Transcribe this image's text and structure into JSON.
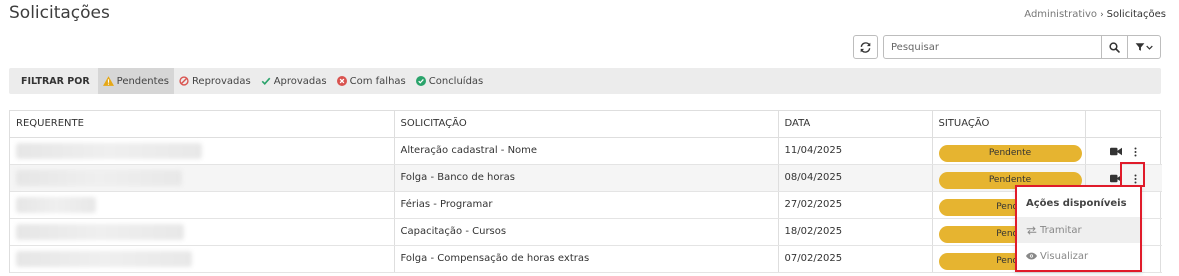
{
  "page": {
    "title": "Solicitações",
    "breadcrumb": {
      "parent": "Administrativo",
      "separator": "›",
      "current": "Solicitações"
    }
  },
  "toolbar": {
    "search_placeholder": "Pesquisar",
    "icons": {
      "refresh": "refresh-icon",
      "search": "search-icon",
      "filter": "filter-icon"
    }
  },
  "filter_bar": {
    "label": "FILTRAR POR",
    "items": [
      {
        "label": "Pendentes",
        "icon": "warning-icon",
        "color": "#e6a817",
        "active": true
      },
      {
        "label": "Reprovadas",
        "icon": "forbidden-icon",
        "color": "#d9534f",
        "active": false
      },
      {
        "label": "Aprovadas",
        "icon": "check-icon",
        "color": "#2aa36b",
        "active": false
      },
      {
        "label": "Com falhas",
        "icon": "error-icon",
        "color": "#d9534f",
        "active": false
      },
      {
        "label": "Concluídas",
        "icon": "check-circle-icon",
        "color": "#2aa36b",
        "active": false
      }
    ]
  },
  "table": {
    "columns": [
      "REQUERENTE",
      "SOLICITAÇÃO",
      "DATA",
      "SITUAÇÃO"
    ],
    "rows": [
      {
        "requester_redacted": true,
        "solicitacao": "Alteração cadastral - Nome",
        "data": "11/04/2025",
        "situacao": "Pendente"
      },
      {
        "requester_redacted": true,
        "solicitacao": "Folga - Banco de horas",
        "data": "08/04/2025",
        "situacao": "Pendente"
      },
      {
        "requester_redacted": true,
        "solicitacao": "Férias - Programar",
        "data": "27/02/2025",
        "situacao": "Pende"
      },
      {
        "requester_redacted": true,
        "solicitacao": "Capacitação - Cursos",
        "data": "18/02/2025",
        "situacao": "Pende"
      },
      {
        "requester_redacted": true,
        "solicitacao": "Folga - Compensação de horas extras",
        "data": "07/02/2025",
        "situacao": "Pende"
      }
    ]
  },
  "actions_menu": {
    "header": "Ações disponíveis",
    "items": [
      {
        "label": "Tramitar",
        "icon": "transfer-icon"
      },
      {
        "label": "Visualizar",
        "icon": "eye-icon"
      }
    ]
  },
  "colors": {
    "status_pending": "#e6b430",
    "highlight": "#e01b2a"
  }
}
